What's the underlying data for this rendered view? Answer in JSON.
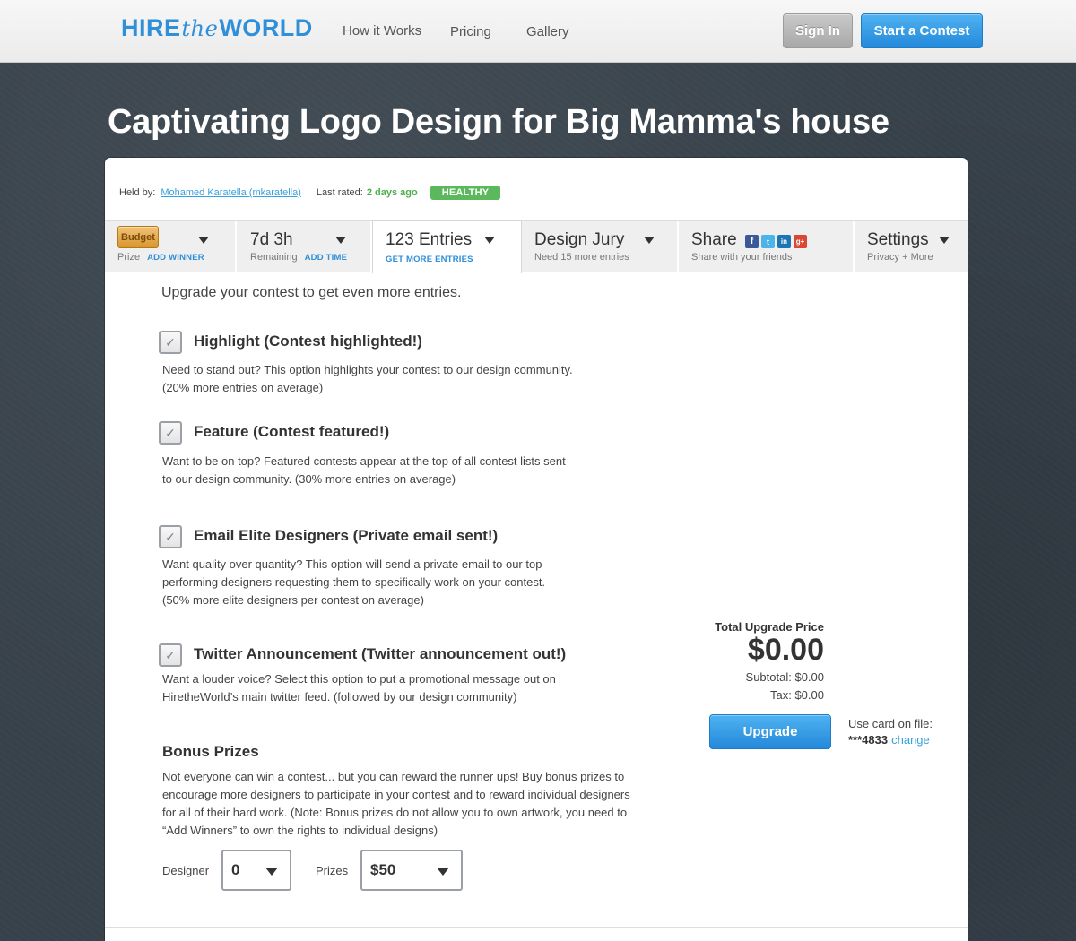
{
  "header": {
    "logo": {
      "hire": "HIRE",
      "the": "the",
      "world": "WORLD"
    },
    "nav": [
      "How it Works",
      "Pricing",
      "Gallery"
    ],
    "sign_in": "Sign In",
    "start_contest": "Start a Contest"
  },
  "title": "Captivating Logo Design for Big Mamma's house",
  "meta": {
    "held_by_label": "Held by:",
    "held_by_name": "Mohamed Karatella (mkaratella)",
    "last_rated_label": "Last rated:",
    "last_rated_value": "2 days ago",
    "status": "HEALTHY"
  },
  "tabs": {
    "budget": {
      "badge": "Budget",
      "sub": "Prize",
      "action": "ADD WINNER"
    },
    "time": {
      "main": "7d 3h",
      "sub": "Remaining",
      "action": "ADD TIME"
    },
    "entries": {
      "main": "123 Entries",
      "action": "GET MORE ENTRIES"
    },
    "jury": {
      "main": "Design Jury",
      "sub": "Need 15 more entries"
    },
    "share": {
      "main": "Share",
      "sub": "Share with your friends",
      "icons": [
        "f",
        "t",
        "in",
        "g+"
      ]
    },
    "settings": {
      "main": "Settings",
      "sub": "Privacy + More"
    }
  },
  "intro": "Upgrade your contest to get even more entries.",
  "options": [
    {
      "title": "Highlight (Contest highlighted!)",
      "desc1": "Need to stand out? This option highlights your contest to our design community.",
      "desc2": "(20% more entries on average)",
      "desc3": ""
    },
    {
      "title": "Feature (Contest featured!)",
      "desc1": "Want to be on top? Featured contests appear at the top of all contest lists sent",
      "desc2": "to our design community. (30% more entries on average)",
      "desc3": ""
    },
    {
      "title": "Email Elite Designers (Private email sent!)",
      "desc1": "Want quality over quantity? This option will send a private email to our top",
      "desc2": "performing designers requesting them to specifically work on your contest.",
      "desc3": "(50% more elite designers per contest on average)"
    },
    {
      "title": "Twitter Announcement (Twitter announcement out!)",
      "desc1": "Want a louder voice? Select this option to put a promotional message out on",
      "desc2": "HiretheWorld’s main twitter feed. (followed by our design community)",
      "desc3": ""
    }
  ],
  "checkmark": "✓",
  "pricing": {
    "label": "Total Upgrade Price",
    "total": "$0.00",
    "subtotal": "Subtotal: $0.00",
    "tax": "Tax: $0.00",
    "upgrade": "Upgrade",
    "card_label": "Use card on file:",
    "card_number": "***4833",
    "change": "change"
  },
  "bonus": {
    "title": "Bonus Prizes",
    "lines": [
      "Not everyone can win a contest... but you can reward the runner ups! Buy bonus prizes to",
      "encourage more designers to participate in your contest and to reward individual designers",
      "for all of their hard work. (Note: Bonus prizes do not allow you to own artwork, you need to",
      "“Add Winners” to own the rights to individual designs)"
    ],
    "designer_label": "Designer",
    "designer_value": "0",
    "prizes_label": "Prizes",
    "prizes_value": "$50"
  }
}
